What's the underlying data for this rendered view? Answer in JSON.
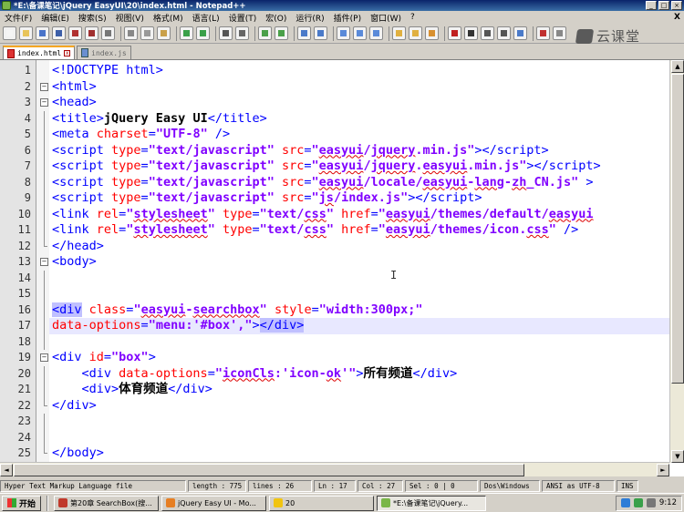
{
  "window": {
    "title": "*E:\\备课笔记\\jQuery EasyUI\\20\\index.html - Notepad++",
    "min_glyph": "_",
    "max_glyph": "□",
    "close_glyph": "×"
  },
  "menu": {
    "items": [
      "文件(F)",
      "编辑(E)",
      "搜索(S)",
      "视图(V)",
      "格式(M)",
      "语言(L)",
      "设置(T)",
      "宏(O)",
      "运行(R)",
      "插件(P)",
      "窗口(W)",
      "?"
    ],
    "close_glyph": "X"
  },
  "toolbar": {
    "logo_text": "云课堂"
  },
  "tabs": [
    {
      "label": "index.html",
      "active": true,
      "close_glyph": "x"
    },
    {
      "label": "index.js",
      "active": false
    }
  ],
  "editor": {
    "line_numbers": [
      "1",
      "2",
      "3",
      "4",
      "5",
      "6",
      "7",
      "8",
      "9",
      "10",
      "11",
      "12",
      "13",
      "14",
      "15",
      "16",
      "17",
      "18",
      "19",
      "20",
      "21",
      "22",
      "23",
      "24",
      "25"
    ],
    "current_line": 17,
    "ibeam_glyph": "I",
    "scroll_up": "▲",
    "scroll_down": "▼",
    "scroll_left": "◄",
    "scroll_right": "►"
  },
  "status": {
    "file_type": "Hyper Text Markup Language file",
    "length": "length : 775",
    "lines": "lines : 26",
    "ln": "Ln : 17",
    "col": "Col : 27",
    "sel": "Sel : 0 | 0",
    "eol": "Dos\\Windows",
    "encoding": "ANSI as UTF-8",
    "mode": "INS"
  },
  "taskbar": {
    "start_label": "开始",
    "tasks": [
      {
        "label": "第20章 SearchBox(搜...",
        "color": "#c0392b",
        "active": false
      },
      {
        "label": "jQuery Easy UI - Mo...",
        "color": "#e67e22",
        "active": false
      },
      {
        "label": "20",
        "color": "#f1c40f",
        "active": false
      },
      {
        "label": "*E:\\备课笔记\\jQuery...",
        "color": "#7ab648",
        "active": true
      }
    ],
    "clock": "9:12"
  }
}
